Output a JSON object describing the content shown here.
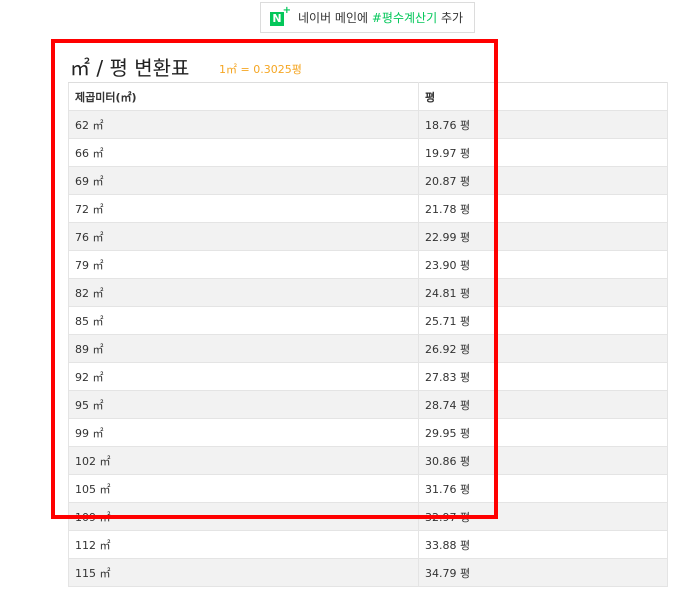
{
  "naver_banner": {
    "icon_letter": "N",
    "icon_plus": "+",
    "prefix": "네이버 메인에 ",
    "keyword": "#평수계산기",
    "suffix": " 추가"
  },
  "title": "㎡ / 평 변환표",
  "formula": "1㎡ = 0.3025평",
  "table": {
    "headers": [
      "제곱미터(㎡)",
      "평"
    ],
    "rows": [
      [
        "62 ㎡",
        "18.76 평"
      ],
      [
        "66 ㎡",
        "19.97 평"
      ],
      [
        "69 ㎡",
        "20.87 평"
      ],
      [
        "72 ㎡",
        "21.78 평"
      ],
      [
        "76 ㎡",
        "22.99 평"
      ],
      [
        "79 ㎡",
        "23.90 평"
      ],
      [
        "82 ㎡",
        "24.81 평"
      ],
      [
        "85 ㎡",
        "25.71 평"
      ],
      [
        "89 ㎡",
        "26.92 평"
      ],
      [
        "92 ㎡",
        "27.83 평"
      ],
      [
        "95 ㎡",
        "28.74 평"
      ],
      [
        "99 ㎡",
        "29.95 평"
      ],
      [
        "102 ㎡",
        "30.86 평"
      ],
      [
        "105 ㎡",
        "31.76 평"
      ],
      [
        "109 ㎡",
        "32.97 평"
      ],
      [
        "112 ㎡",
        "33.88 평"
      ],
      [
        "115 ㎡",
        "34.79 평"
      ]
    ]
  },
  "colors": {
    "naver_green": "#03c75a",
    "formula_orange": "#f5a623",
    "highlight_red": "#ff0000"
  }
}
